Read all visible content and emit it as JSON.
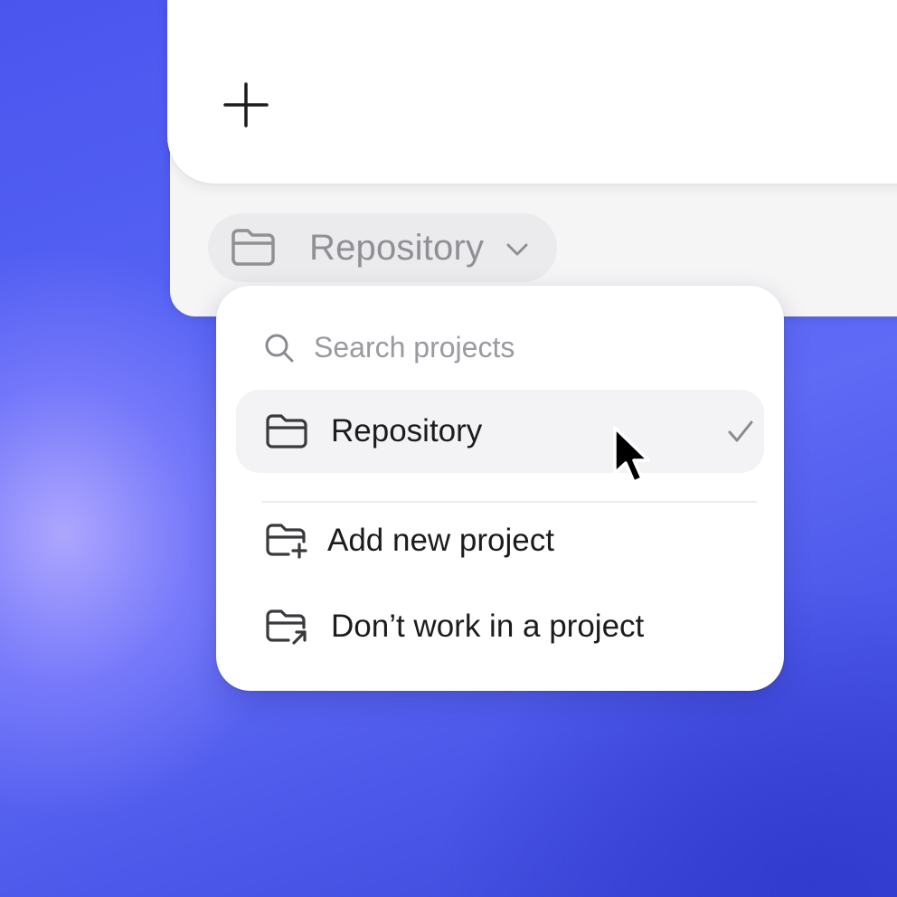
{
  "composer": {
    "add_button_icon": "plus-icon"
  },
  "project_chip": {
    "icon": "folder-icon",
    "label": "Repository",
    "chevron": "chevron-down-icon"
  },
  "dropdown": {
    "search": {
      "icon": "search-icon",
      "placeholder": "Search projects",
      "value": ""
    },
    "items": [
      {
        "icon": "folder-icon",
        "label": "Repository",
        "selected": true,
        "selected_icon": "checkmark-icon"
      },
      {
        "icon": "folder-plus-icon",
        "label": "Add new project"
      },
      {
        "icon": "folder-arrow-icon",
        "label": "Don’t work in a project"
      }
    ]
  },
  "colors": {
    "chip_background": "#ebebed",
    "chip_text": "#8f8f95",
    "menu_text": "#1c1c1e",
    "selected_background": "#f3f3f5"
  }
}
